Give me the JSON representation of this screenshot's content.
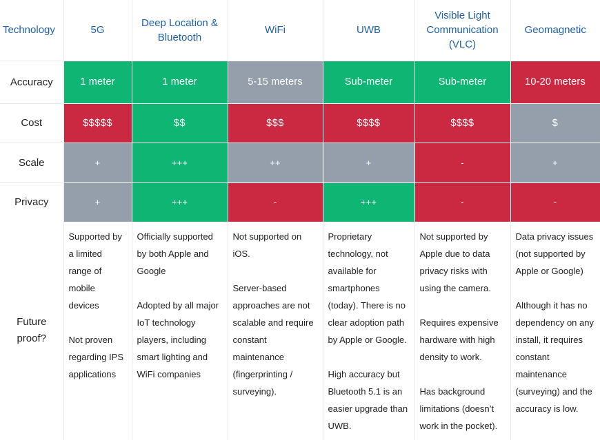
{
  "table": {
    "headers": [
      {
        "label": "Technology"
      },
      {
        "label": "5G"
      },
      {
        "label": "Deep Location & Bluetooth"
      },
      {
        "label": "WiFi"
      },
      {
        "label": "UWB"
      },
      {
        "label": "Visible Light Communication (VLC)"
      },
      {
        "label": "Geomagnetic"
      }
    ],
    "row_labels": {
      "accuracy": "Accuracy",
      "cost": "Cost",
      "scale": "Scale",
      "privacy": "Privacy",
      "future": "Future proof?"
    },
    "accuracy": [
      {
        "value": "1 meter",
        "rating": "green"
      },
      {
        "value": "1 meter",
        "rating": "green"
      },
      {
        "value": "5-15 meters",
        "rating": "gray"
      },
      {
        "value": "Sub-meter",
        "rating": "green"
      },
      {
        "value": "Sub-meter",
        "rating": "green"
      },
      {
        "value": "10-20 meters",
        "rating": "red"
      }
    ],
    "cost": [
      {
        "value": "$$$$$",
        "rating": "red"
      },
      {
        "value": "$$",
        "rating": "green"
      },
      {
        "value": "$$$",
        "rating": "red"
      },
      {
        "value": "$$$$",
        "rating": "red"
      },
      {
        "value": "$$$$",
        "rating": "red"
      },
      {
        "value": "$",
        "rating": "gray"
      }
    ],
    "scale": [
      {
        "value": "+",
        "rating": "gray"
      },
      {
        "value": "+++",
        "rating": "green"
      },
      {
        "value": "++",
        "rating": "gray"
      },
      {
        "value": "+",
        "rating": "gray"
      },
      {
        "value": "-",
        "rating": "red"
      },
      {
        "value": "+",
        "rating": "gray"
      }
    ],
    "privacy": [
      {
        "value": "+",
        "rating": "gray"
      },
      {
        "value": "+++",
        "rating": "green"
      },
      {
        "value": "-",
        "rating": "red"
      },
      {
        "value": "+++",
        "rating": "green"
      },
      {
        "value": "-",
        "rating": "red"
      },
      {
        "value": "-",
        "rating": "red"
      }
    ],
    "future": [
      {
        "p1": "Supported by a limited range of mobile devices",
        "p2": "Not proven regarding IPS applications"
      },
      {
        "p1": "Officially supported by both Apple and Google",
        "p2": "Adopted by all major IoT technology players, including smart lighting and WiFi companies"
      },
      {
        "p1": "Not supported on iOS.",
        "p2": "Server-based approaches are not scalable and require constant maintenance (fingerprinting / surveying)."
      },
      {
        "p1": "Proprietary technology, not available for smartphones (today). There is no clear adoption path by Apple or Google.",
        "p2": "High accuracy but Bluetooth 5.1 is an easier upgrade than UWB."
      },
      {
        "p1": "Not supported by Apple due to data privacy risks with using the camera.",
        "p2": "Requires expensive hardware with high density to work.",
        "p3": "Has background limitations (doesn’t work in the pocket)."
      },
      {
        "p1": "Data privacy issues (not supported by Apple or Google)",
        "p2": "Although it has no dependency on any install, it requires constant maintenance (surveying) and the accuracy is low."
      }
    ]
  },
  "colors": {
    "green": "#0fb573",
    "red": "#cb2941",
    "gray": "#949fab",
    "header_text": "#1d5fa8",
    "body_text": "#202124",
    "grid": "#e8eaed"
  }
}
